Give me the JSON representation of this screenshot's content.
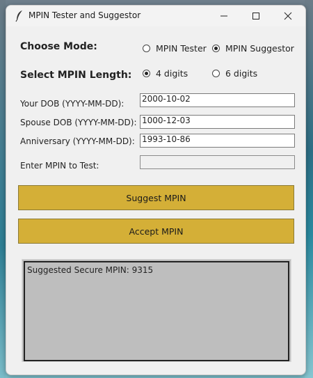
{
  "window": {
    "title": "MPIN Tester and Suggestor"
  },
  "mode": {
    "label": "Choose Mode:",
    "options": [
      {
        "label": "MPIN Tester",
        "selected": false
      },
      {
        "label": "MPIN Suggestor",
        "selected": true
      }
    ]
  },
  "length": {
    "label": "Select MPIN Length:",
    "options": [
      {
        "label": "4 digits",
        "selected": true
      },
      {
        "label": "6 digits",
        "selected": false
      }
    ]
  },
  "fields": {
    "dob": {
      "label": "Your DOB (YYYY-MM-DD):",
      "value": "2000-10-02"
    },
    "spouse_dob": {
      "label": "Spouse DOB (YYYY-MM-DD):",
      "value": "1000-12-03"
    },
    "anniversary": {
      "label": "Anniversary (YYYY-MM-DD):",
      "value": "1993-10-86"
    },
    "mpin": {
      "label": "Enter MPIN to Test:",
      "value": ""
    }
  },
  "buttons": {
    "suggest": "Suggest MPIN",
    "accept": "Accept MPIN"
  },
  "output": {
    "text": "Suggested Secure MPIN: 9315"
  },
  "colors": {
    "accent": "#d4af37",
    "output_bg": "#bebebe"
  }
}
